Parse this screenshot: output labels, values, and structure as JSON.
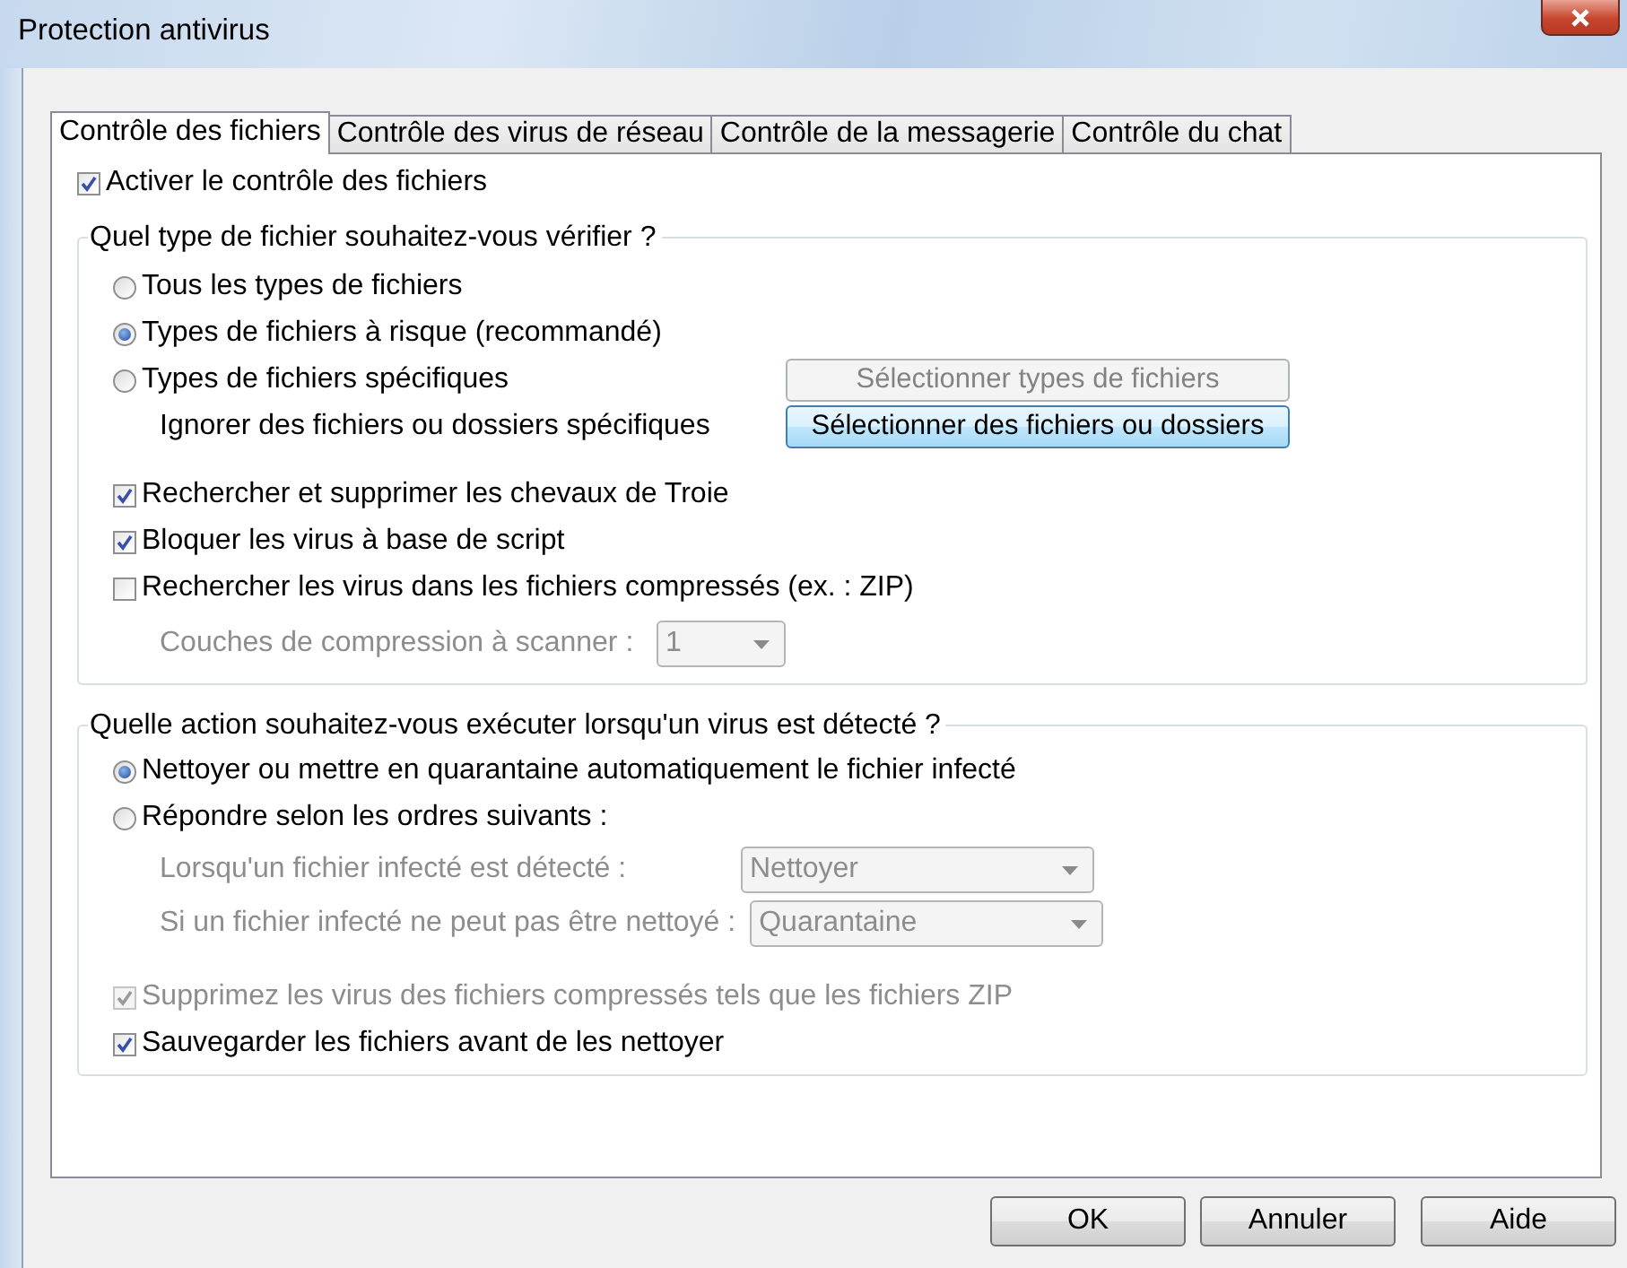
{
  "window": {
    "title": "Protection antivirus"
  },
  "tabs": [
    {
      "label": "Contrôle des fichiers",
      "selected": true
    },
    {
      "label": "Contrôle des virus de réseau",
      "selected": false
    },
    {
      "label": "Contrôle de la messagerie",
      "selected": false
    },
    {
      "label": "Contrôle du chat",
      "selected": false
    }
  ],
  "enable": {
    "label": "Activer le contrôle des fichiers",
    "checked": true
  },
  "groups": [
    {
      "title": "Quel type de fichier souhaitez-vous vérifier ?",
      "items": [
        {
          "kind": "radio",
          "label": "Tous les types de fichiers",
          "selected": false
        },
        {
          "kind": "radio",
          "label": "Types de fichiers à risque (recommandé)",
          "selected": true
        },
        {
          "kind": "radio",
          "label": "Types de fichiers spécifiques",
          "selected": false,
          "button": {
            "label": "Sélectionner types de fichiers",
            "disabled": true,
            "highlighted": false
          }
        },
        {
          "kind": "text",
          "label": "Ignorer des fichiers ou dossiers spécifiques",
          "button": {
            "label": "Sélectionner des fichiers ou dossiers",
            "disabled": false,
            "highlighted": true
          }
        },
        {
          "kind": "checkbox",
          "label": "Rechercher et supprimer les chevaux de Troie",
          "checked": true,
          "disabled": false
        },
        {
          "kind": "checkbox",
          "label": "Bloquer les virus à base de script",
          "checked": true,
          "disabled": false
        },
        {
          "kind": "checkbox",
          "label": "Rechercher les virus dans les fichiers compressés (ex. : ZIP)",
          "checked": false,
          "disabled": false
        },
        {
          "kind": "dropdown",
          "label": "Couches de compression à scanner :",
          "value": "1",
          "disabled": true
        }
      ]
    },
    {
      "title": "Quelle action souhaitez-vous exécuter lorsqu'un virus est détecté ?",
      "items": [
        {
          "kind": "radio",
          "label": "Nettoyer ou mettre en quarantaine automatiquement le fichier infecté",
          "selected": true
        },
        {
          "kind": "radio",
          "label": "Répondre selon les ordres suivants :",
          "selected": false
        },
        {
          "kind": "dropdown",
          "label": "Lorsqu'un fichier infecté est détecté :",
          "value": "Nettoyer",
          "disabled": true
        },
        {
          "kind": "dropdown",
          "label": "Si un fichier infecté ne peut pas être nettoyé :",
          "value": "Quarantaine",
          "disabled": true
        },
        {
          "kind": "checkbox",
          "label": "Supprimez les virus des fichiers compressés tels que les fichiers ZIP",
          "checked": true,
          "disabled": true
        },
        {
          "kind": "checkbox",
          "label": "Sauvegarder les fichiers avant de les nettoyer",
          "checked": true,
          "disabled": false
        }
      ]
    }
  ],
  "buttons": [
    {
      "label": "OK"
    },
    {
      "label": "Annuler"
    },
    {
      "label": "Aide"
    }
  ]
}
